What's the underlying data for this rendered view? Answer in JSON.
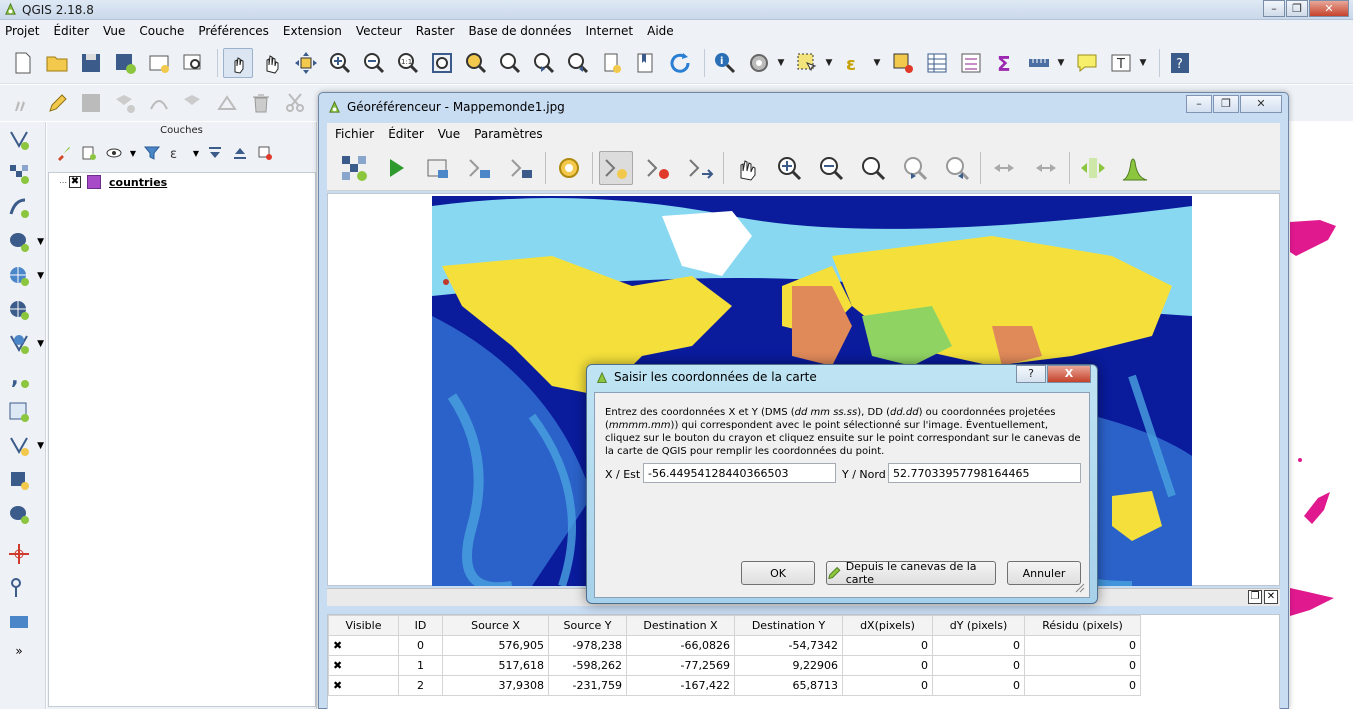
{
  "main_window": {
    "title": "QGIS 2.18.8",
    "menu": [
      "Projet",
      "Éditer",
      "Vue",
      "Couche",
      "Préférences",
      "Extension",
      "Vecteur",
      "Raster",
      "Base de données",
      "Internet",
      "Aide"
    ]
  },
  "layers_panel": {
    "title": "Couches",
    "layers": [
      {
        "name": "countries",
        "checked": true,
        "color": "#a84bc9"
      }
    ]
  },
  "georeferencer": {
    "title": "Géoréférenceur - Mappemonde1.jpg",
    "menu": [
      "Fichier",
      "Éditer",
      "Vue",
      "Paramètres"
    ],
    "gcp_table": {
      "columns": [
        "Visible",
        "ID",
        "Source X",
        "Source Y",
        "Destination X",
        "Destination Y",
        "dX(pixels)",
        "dY (pixels)",
        "Résidu (pixels)"
      ],
      "rows": [
        {
          "visible": "✖",
          "id": "0",
          "src_x": "576,905",
          "src_y": "-978,238",
          "dst_x": "-66,0826",
          "dst_y": "-54,7342",
          "dx": "0",
          "dy": "0",
          "res": "0"
        },
        {
          "visible": "✖",
          "id": "1",
          "src_x": "517,618",
          "src_y": "-598,262",
          "dst_x": "-77,2569",
          "dst_y": "9,22906",
          "dx": "0",
          "dy": "0",
          "res": "0"
        },
        {
          "visible": "✖",
          "id": "2",
          "src_x": "37,9308",
          "src_y": "-231,759",
          "dst_x": "-167,422",
          "dst_y": "65,8713",
          "dx": "0",
          "dy": "0",
          "res": "0"
        }
      ]
    }
  },
  "dialog": {
    "title": "Saisir les coordonnées de la carte",
    "instructions": {
      "p1": "Entrez des coordonnées X et Y (DMS (",
      "i1": "dd mm ss.ss",
      "p2": "), DD (",
      "i2": "dd.dd",
      "p3": ") ou coordonnées projetées (",
      "i3": "mmmm.mm",
      "p4": ")) qui correspondent avec le point sélectionné sur l'image. Éventuellement, cliquez sur le bouton du crayon et cliquez ensuite sur le point correspondant sur le canevas de la carte de QGIS pour remplir les coordonnées du point."
    },
    "x_label": "X / Est",
    "x_value": "-56.44954128440366503",
    "y_label": "Y / Nord",
    "y_value": "52.77033957798164465",
    "ok_label": "OK",
    "from_canvas_label": "Depuis le canevas de la carte",
    "cancel_label": "Annuler",
    "help_label": "?",
    "close_label": "X"
  },
  "icons": {
    "brand_color": "#8cc63f",
    "map_ocean": "#0a1b9c",
    "map_land": "#f5e03b"
  }
}
